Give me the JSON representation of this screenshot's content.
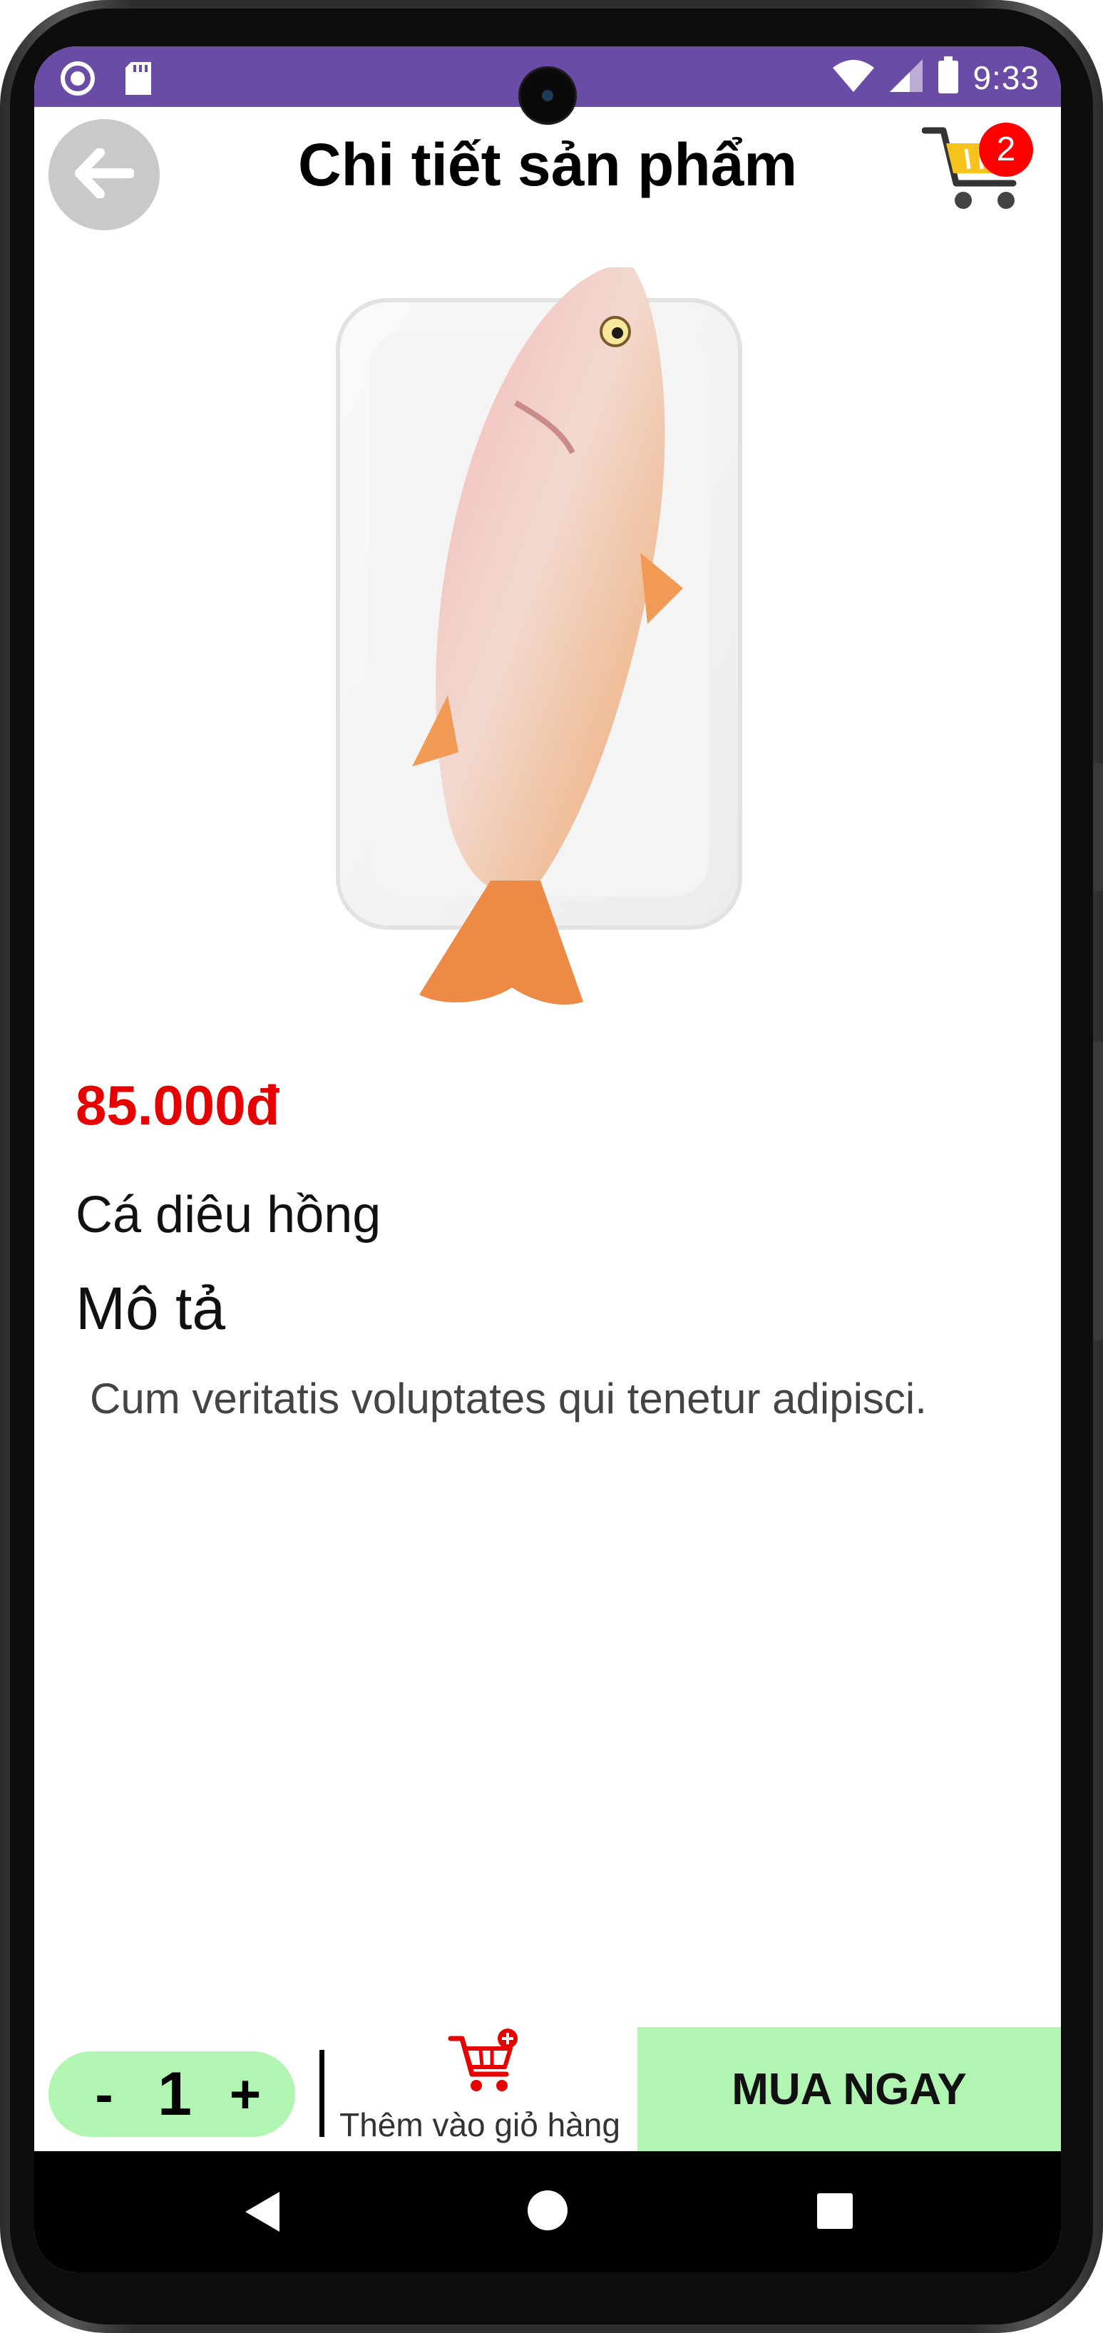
{
  "status_bar": {
    "time": "9:33"
  },
  "header": {
    "title": "Chi tiết sản phẩm",
    "cart_count": "2"
  },
  "product": {
    "price": "85.000đ",
    "name": "Cá diêu hồng",
    "description_heading": "Mô tả",
    "description": "Cum veritatis voluptates qui tenetur adipisci."
  },
  "bottom_bar": {
    "decrement": "-",
    "quantity": "1",
    "increment": "+",
    "add_to_cart": "Thêm vào giỏ hàng",
    "buy_now": "MUA NGAY"
  },
  "colors": {
    "status_bar": "#6A4BA6",
    "price": "#e60000",
    "accent_green": "#b1f5b3",
    "badge": "#ff0000"
  }
}
